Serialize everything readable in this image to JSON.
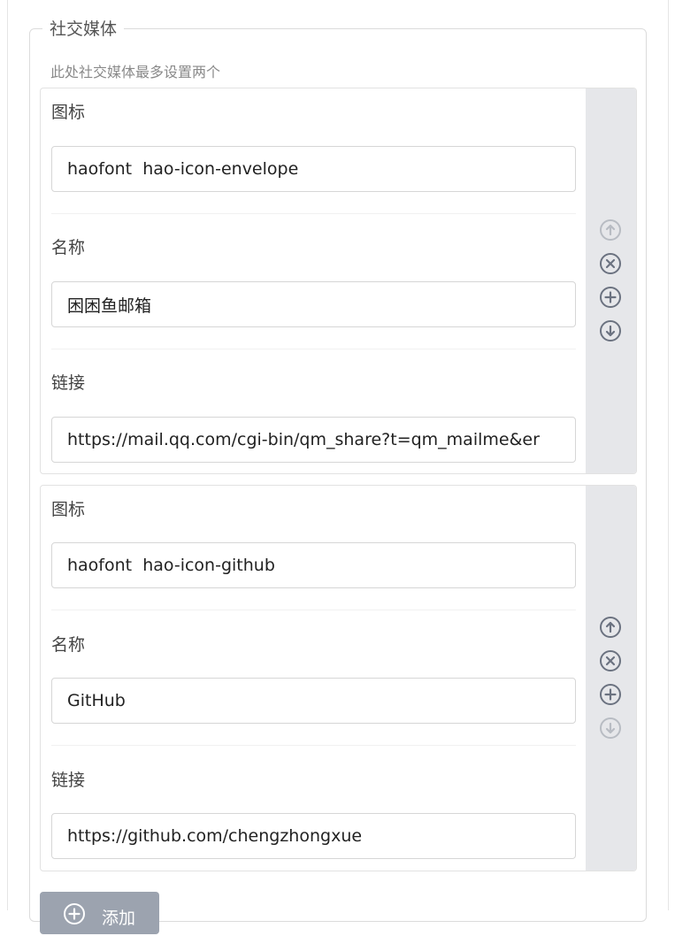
{
  "section": {
    "legend": "社交媒体",
    "hint": "此处社交媒体最多设置两个"
  },
  "groups": [
    {
      "icon_label": "图标",
      "icon_value": "haofont  hao-icon-envelope",
      "name_label": "名称",
      "name_value": "困困鱼邮箱",
      "link_label": "链接",
      "link_value": "https://mail.qq.com/cgi-bin/qm_share?t=qm_mailme&er",
      "controls": {
        "up_disabled": true,
        "down_disabled": false
      }
    },
    {
      "icon_label": "图标",
      "icon_value": "haofont  hao-icon-github",
      "name_label": "名称",
      "name_value": "GitHub",
      "link_label": "链接",
      "link_value": "https://github.com/chengzhongxue",
      "controls": {
        "up_disabled": false,
        "down_disabled": true
      }
    }
  ],
  "add_button": {
    "label": "添加",
    "icon": "plus-circle-icon"
  },
  "icons": {
    "move_up": "arrow-up-circle-icon",
    "remove": "x-circle-icon",
    "insert": "plus-circle-icon",
    "move_down": "arrow-down-circle-icon"
  },
  "colors": {
    "sidebar_bg": "#e6e7ea",
    "control_active": "#6b7280",
    "control_disabled": "#b8bcc3",
    "add_button_bg": "#9ca3af"
  }
}
